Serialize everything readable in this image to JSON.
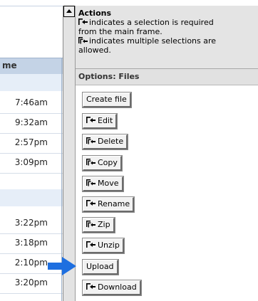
{
  "list": {
    "header": "me",
    "times": [
      "7:46am",
      "9:32am",
      "2:57pm",
      "3:09pm",
      "3:22pm",
      "3:18pm",
      "2:10pm",
      "3:20pm"
    ]
  },
  "actions": {
    "title": "Actions",
    "line1": "indicates a selection is required",
    "line2": "from the main frame.",
    "line3": "indicates multiple selections are",
    "line4": "allowed."
  },
  "options": {
    "title": "Options: Files",
    "buttons": [
      "Create file",
      "Edit",
      "Delete",
      "Copy",
      "Move",
      "Rename",
      "Zip",
      "Unzip",
      "Upload",
      "Download"
    ]
  },
  "icons": {
    "single": "single-select-icon",
    "multi": "multi-select-icon",
    "pointer": "blue-arrow-icon",
    "scroll": "scroll-up-arrow-icon"
  },
  "colors": {
    "header_bg": "#c4d3e6",
    "arrow": "#1e6fe0"
  }
}
